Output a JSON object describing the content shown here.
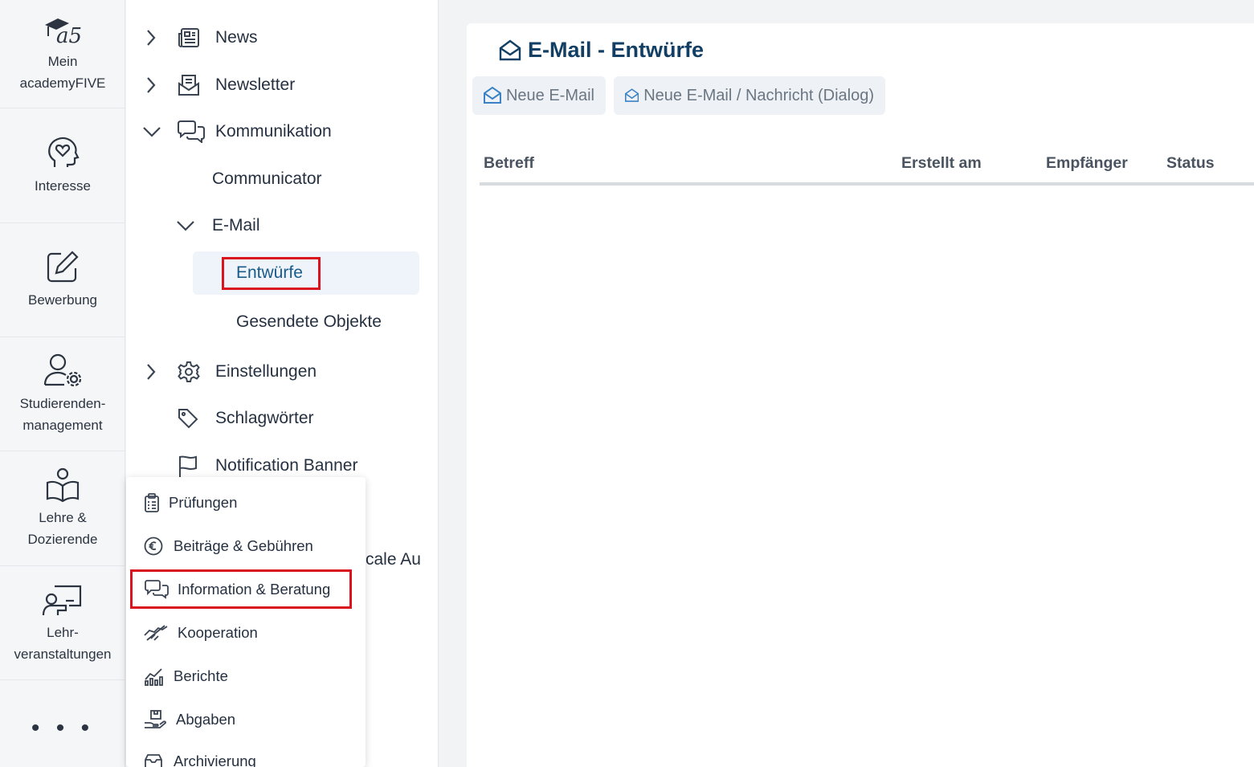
{
  "rail": {
    "items": [
      {
        "label": "Mein\nacademyFIVE",
        "icon": "academyfive-logo-icon"
      },
      {
        "label": "Interesse",
        "icon": "head-heart-icon"
      },
      {
        "label": "Bewerbung",
        "icon": "edit-icon"
      },
      {
        "label": "Studierenden-\nmanagement",
        "icon": "user-gear-icon"
      },
      {
        "label": "Lehre &\nDozierende",
        "icon": "book-reader-icon"
      },
      {
        "label": "Lehr-\nveranstaltungen",
        "icon": "presentation-icon"
      }
    ],
    "more": "• • •"
  },
  "tree": {
    "news": "News",
    "newsletter": "Newsletter",
    "kommunikation": "Kommunikation",
    "communicator": "Communicator",
    "email": "E-Mail",
    "entwuerfe": "Entwürfe",
    "gesendete": "Gesendete Objekte",
    "einstellungen": "Einstellungen",
    "schlagwoerter": "Schlagwörter",
    "notification": "Notification Banner",
    "partial": "cale Au"
  },
  "flyout": {
    "items": [
      {
        "label": "Prüfungen",
        "icon": "clipboard-icon"
      },
      {
        "label": "Beiträge & Gebühren",
        "icon": "euro-icon"
      },
      {
        "label": "Information & Beratung",
        "icon": "chat-bubbles-icon"
      },
      {
        "label": "Kooperation",
        "icon": "handshake-icon"
      },
      {
        "label": "Berichte",
        "icon": "bar-chart-icon"
      },
      {
        "label": "Abgaben",
        "icon": "hand-box-icon"
      },
      {
        "label": "Archivierung",
        "icon": "archive-icon"
      }
    ]
  },
  "main": {
    "title": "E-Mail - Entwürfe",
    "buttons": {
      "new_email": "Neue E-Mail",
      "new_email_dialog": "Neue E-Mail / Nachricht (Dialog)"
    },
    "columns": [
      "Betreff",
      "Erstellt am",
      "Empfänger",
      "Status"
    ]
  },
  "colors": {
    "highlight": "#d9141e",
    "accent": "#123f63",
    "selected": "#1a5a8a"
  }
}
